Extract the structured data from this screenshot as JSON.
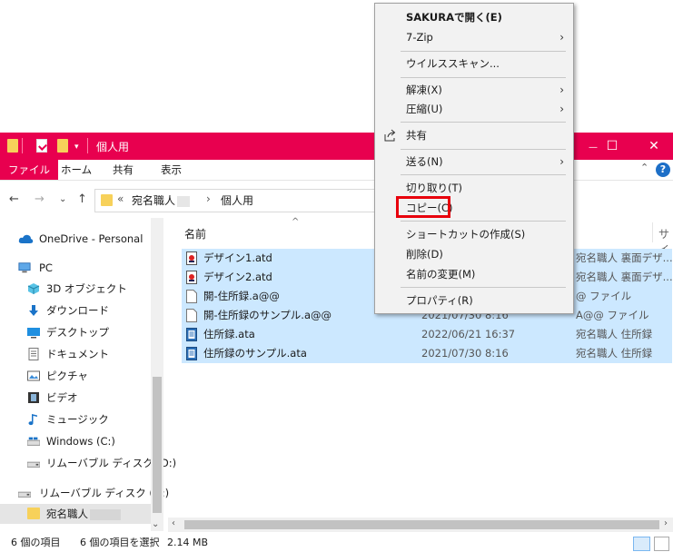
{
  "window": {
    "title": "個人用",
    "minimize": "—",
    "maximize": "☐",
    "close": "✕"
  },
  "ribbon": {
    "tabs": [
      "ファイル",
      "ホーム",
      "共有",
      "表示"
    ],
    "collapse_glyph": "⌃",
    "help_glyph": "?"
  },
  "address": {
    "back": "←",
    "forward": "→",
    "recent": "⌄",
    "up": "↑",
    "prefix": "«",
    "crumbs": [
      "宛名職人",
      "個人用"
    ],
    "separator": "›"
  },
  "nav": {
    "items": [
      {
        "label": "OneDrive - Personal",
        "icon": "cloud-icon"
      },
      {
        "label": "PC",
        "icon": "computer-icon"
      },
      {
        "label": "3D オブジェクト",
        "icon": "cube-icon"
      },
      {
        "label": "ダウンロード",
        "icon": "download-icon"
      },
      {
        "label": "デスクトップ",
        "icon": "desktop-icon"
      },
      {
        "label": "ドキュメント",
        "icon": "document-icon"
      },
      {
        "label": "ピクチャ",
        "icon": "picture-icon"
      },
      {
        "label": "ビデオ",
        "icon": "video-icon"
      },
      {
        "label": "ミュージック",
        "icon": "music-icon"
      },
      {
        "label": "Windows (C:)",
        "icon": "drive-icon"
      },
      {
        "label": "リムーバブル ディスク (D:)",
        "icon": "usb-drive-icon"
      },
      {
        "label": "リムーバブル ディスク (D:)",
        "icon": "usb-drive-icon"
      },
      {
        "label": "宛名職人",
        "icon": "folder-icon"
      }
    ]
  },
  "list": {
    "col_name": "名前",
    "col_size_partial": "サイ",
    "sort_glyph": "^",
    "rows": [
      {
        "name": "デザイン1.atd",
        "date": "",
        "type": "宛名職人 裏面デザ..."
      },
      {
        "name": "デザイン2.atd",
        "date": "",
        "type": "宛名職人 裏面デザ..."
      },
      {
        "name": "開-住所録.a@@",
        "date": "",
        "type": "@ ファイル"
      },
      {
        "name": "開-住所録のサンプル.a@@",
        "date": "2021/07/30 8:16",
        "type": "A@@ ファイル"
      },
      {
        "name": "住所録.ata",
        "date": "2022/06/21 16:37",
        "type": "宛名職人 住所録"
      },
      {
        "name": "住所録のサンプル.ata",
        "date": "2021/07/30 8:16",
        "type": "宛名職人 住所録"
      }
    ]
  },
  "status": {
    "count": "6 個の項目",
    "selected": "6 個の項目を選択",
    "size": "2.14 MB"
  },
  "menu": {
    "items": [
      {
        "label": "SAKURAで開く(E)",
        "bold": true
      },
      {
        "label": "7-Zip",
        "arrow": "›"
      },
      {
        "label": "ウイルススキャン..."
      },
      {
        "label": "解凍(X)",
        "arrow": "›"
      },
      {
        "label": "圧縮(U)",
        "arrow": "›"
      },
      {
        "label": "共有"
      },
      {
        "label": "送る(N)",
        "arrow": "›"
      },
      {
        "label": "切り取り(T)"
      },
      {
        "label": "コピー(C)"
      },
      {
        "label": "ショートカットの作成(S)"
      },
      {
        "label": "削除(D)"
      },
      {
        "label": "名前の変更(M)"
      },
      {
        "label": "プロパティ(R)"
      }
    ]
  },
  "colors": {
    "accent": "#e8004f",
    "selection": "#cce8ff",
    "highlight_box": "#e8000c"
  }
}
